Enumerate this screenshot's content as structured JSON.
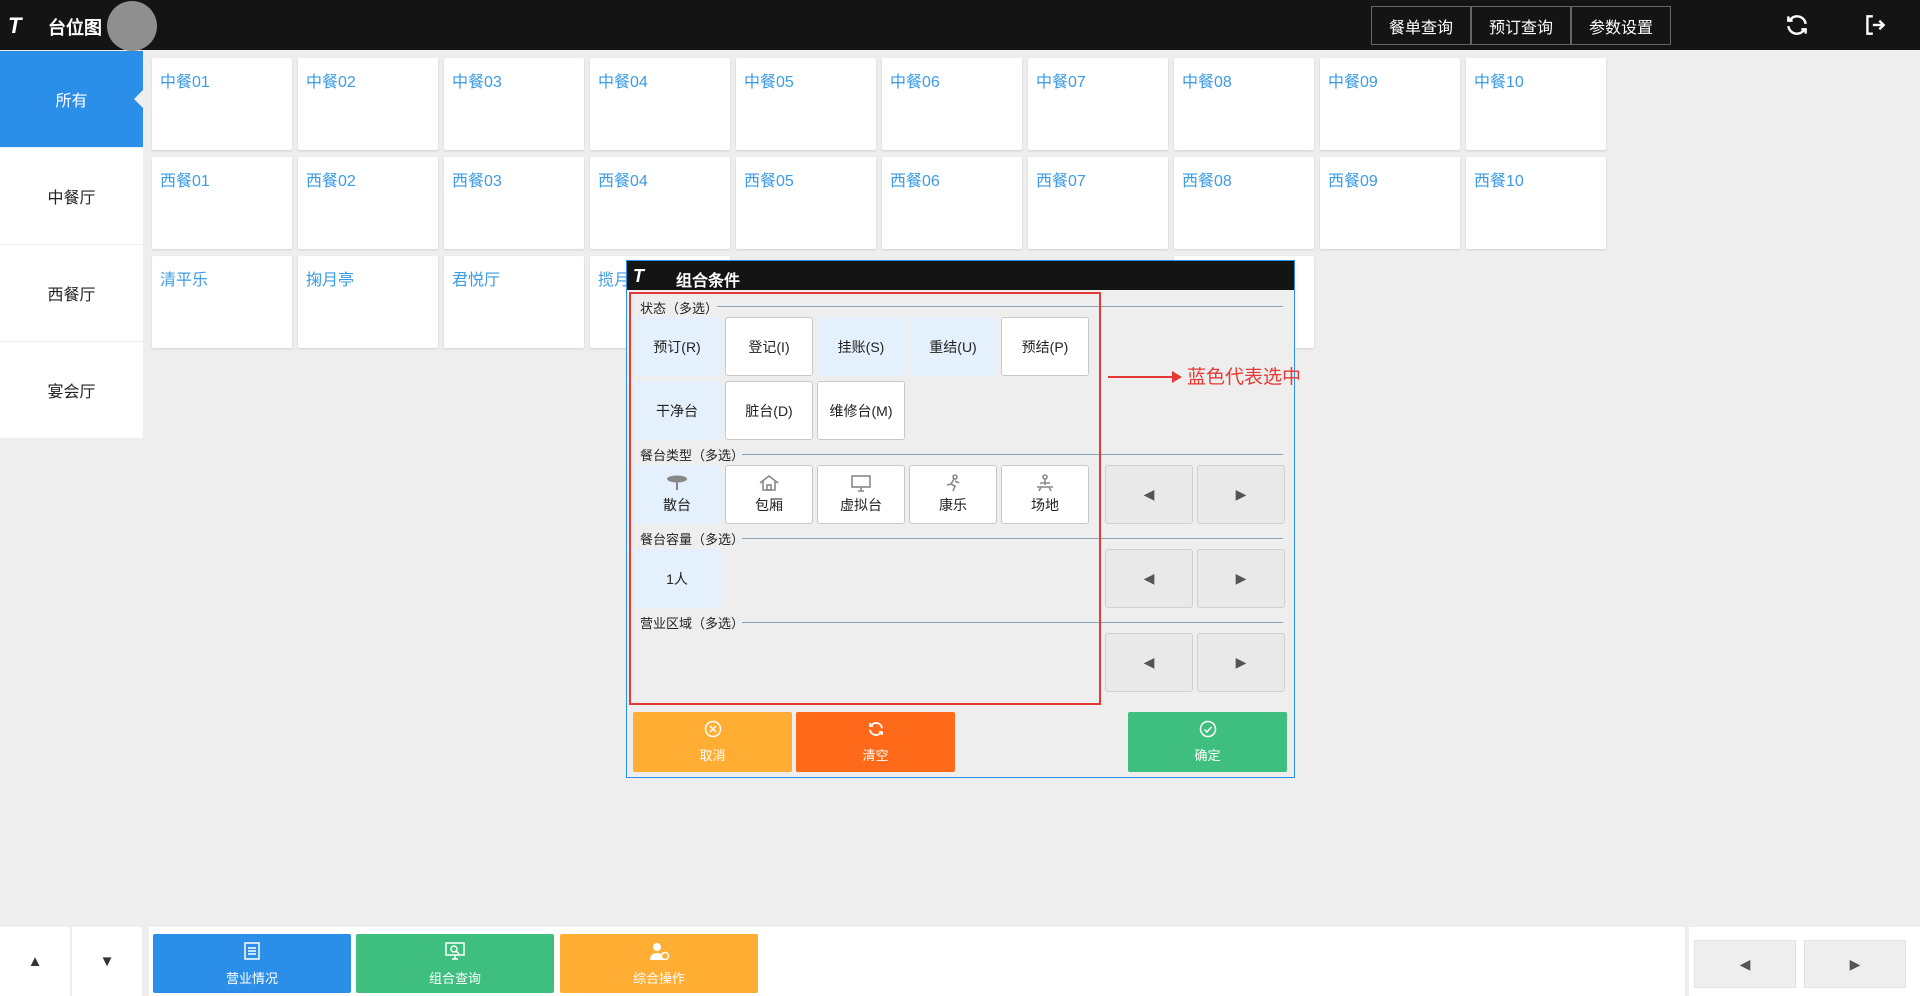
{
  "header": {
    "logo_text": "T",
    "title": "台位图",
    "buttons": [
      "餐单查询",
      "预订查询",
      "参数设置"
    ],
    "icons": [
      "refresh-icon",
      "logout-icon"
    ]
  },
  "sidebar": {
    "items": [
      "所有",
      "中餐厅",
      "西餐厅",
      "宴会厅"
    ],
    "active_index": 0
  },
  "tables": {
    "row1": [
      "中餐01",
      "中餐02",
      "中餐03",
      "中餐04",
      "中餐05",
      "中餐06",
      "中餐07",
      "中餐08",
      "中餐09",
      "中餐10"
    ],
    "row2": [
      "西餐01",
      "西餐02",
      "西餐03",
      "西餐04",
      "西餐05",
      "西餐06",
      "西餐07",
      "西餐08",
      "西餐09",
      "西餐10"
    ],
    "row3": [
      "清平乐",
      "掬月亭",
      "君悦厅",
      "揽月"
    ]
  },
  "modal": {
    "logo_text": "T",
    "title": "组合条件",
    "status": {
      "label": "状态（多选）",
      "options": [
        "预订(R)",
        "登记(I)",
        "挂账(S)",
        "重结(U)",
        "预结(P)",
        "干净台",
        "脏台(D)",
        "维修台(M)"
      ],
      "selected": [
        0,
        2,
        3,
        5
      ]
    },
    "table_type": {
      "label": "餐台类型（多选）",
      "options": [
        "散台",
        "包厢",
        "虚拟台",
        "康乐",
        "场地"
      ],
      "icons": [
        "round-table-icon",
        "house-icon",
        "monitor-icon",
        "recreation-icon",
        "venue-icon"
      ],
      "selected": [
        0
      ]
    },
    "capacity": {
      "label": "餐台容量（多选）",
      "options": [
        "1人"
      ],
      "selected": [
        0
      ]
    },
    "area": {
      "label": "营业区域（多选）",
      "options": []
    },
    "buttons": {
      "cancel": "取消",
      "clear": "清空",
      "confirm": "确定"
    }
  },
  "annotation": {
    "text": "蓝色代表选中"
  },
  "footer": {
    "buttons": [
      "营业情况",
      "组合查询",
      "综合操作"
    ]
  },
  "colors": {
    "blue": "#2b8ee8",
    "green": "#3fbf7f",
    "orange": "#ffad33",
    "red_orange": "#ff6a1a",
    "annotation_red": "#e53935",
    "selected_bg": "#e4f0fb"
  }
}
